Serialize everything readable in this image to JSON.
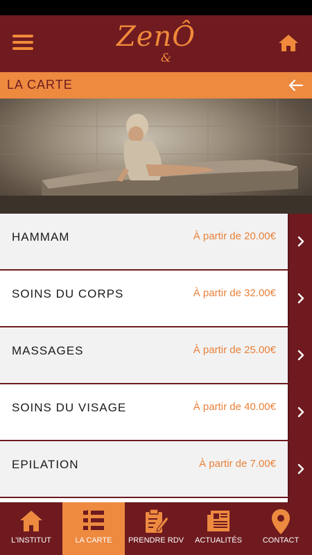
{
  "app": {
    "logo_text": "Zen",
    "logo_accent": "Ô",
    "logo_amp": "&",
    "colors": {
      "primary": "#6e1a1f",
      "accent": "#ed8a40",
      "price": "#e8813a"
    }
  },
  "header": {
    "menu_icon": "hamburger-menu-icon",
    "home_icon": "home-icon"
  },
  "section": {
    "title": "LA CARTE",
    "back_icon": "arrow-left-icon"
  },
  "hero": {
    "image": "woman-in-towel-hammam-photo"
  },
  "items": [
    {
      "name": "HAMMAM",
      "price": "À partir de 20.00€"
    },
    {
      "name": "SOINS DU CORPS",
      "price": "À partir de 32.00€"
    },
    {
      "name": "MASSAGES",
      "price": "À partir de 25.00€"
    },
    {
      "name": "SOINS DU VISAGE",
      "price": "À partir de 40.00€"
    },
    {
      "name": "EPILATION",
      "price": "À partir de 7.00€"
    }
  ],
  "tabs": [
    {
      "label": "L'INSTITUT",
      "icon": "home-icon",
      "active": false
    },
    {
      "label": "LA CARTE",
      "icon": "list-icon",
      "active": true
    },
    {
      "label": "PRENDRE RDV",
      "icon": "appointment-icon",
      "active": false
    },
    {
      "label": "ACTUALITÉS",
      "icon": "newspaper-icon",
      "active": false
    },
    {
      "label": "CONTACT",
      "icon": "location-pin-icon",
      "active": false
    }
  ]
}
